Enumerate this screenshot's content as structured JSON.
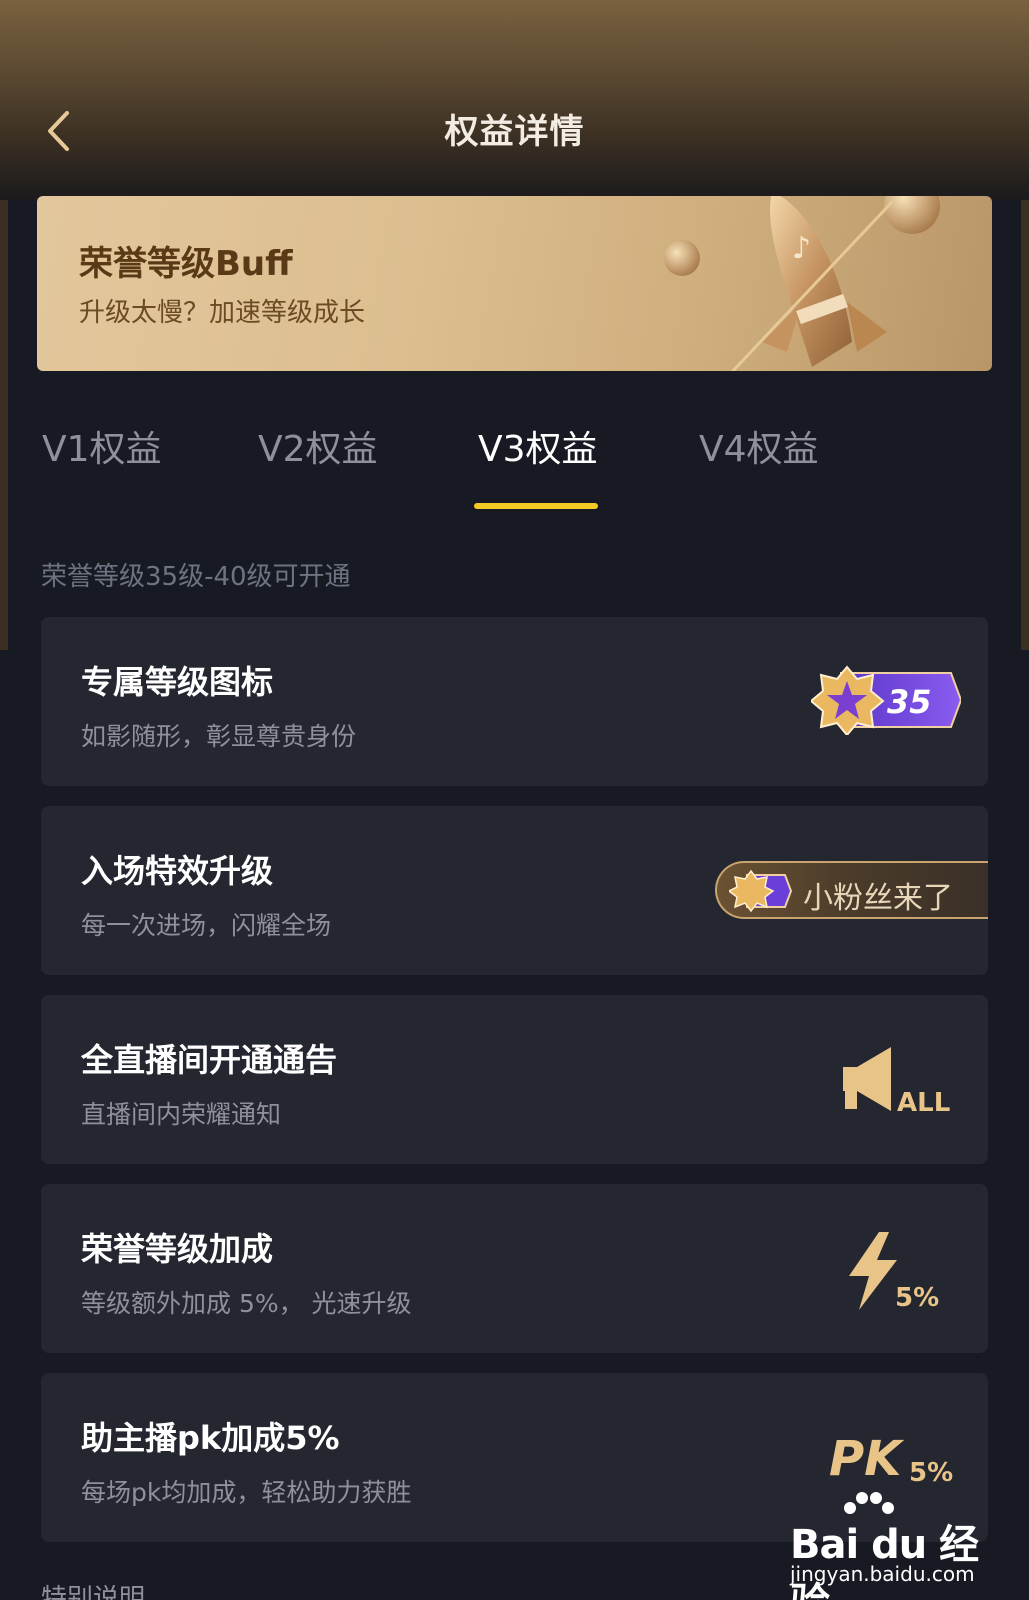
{
  "header": {
    "title": "权益详情"
  },
  "banner": {
    "title": "荣誉等级Buff",
    "subtitle": "升级太慢？加速等级成长"
  },
  "tabs": [
    {
      "label": "V1权益",
      "active": false
    },
    {
      "label": "V2权益",
      "active": false
    },
    {
      "label": "V3权益",
      "active": true
    },
    {
      "label": "V4权益",
      "active": false
    }
  ],
  "unlock_note": "荣誉等级35级-40级可开通",
  "benefits": [
    {
      "title": "专属等级图标",
      "subtitle": "如影随形，彰显尊贵身份",
      "badge_value": "35"
    },
    {
      "title": "入场特效升级",
      "subtitle": "每一次进场，闪耀全场",
      "effect_text": "小粉丝来了"
    },
    {
      "title": "全直播间开通通告",
      "subtitle": "直播间内荣耀通知",
      "icon_text": "ALL"
    },
    {
      "title": "荣誉等级加成",
      "subtitle": "等级额外加成 5%， 光速升级",
      "icon_text": "5%"
    },
    {
      "title": "助主播pk加成5%",
      "subtitle": "每场pk均加成，轻松助力获胜",
      "icon_text_main": "PK",
      "icon_text_sub": "5%"
    }
  ],
  "footer_note": "特别说明",
  "watermark": {
    "brand": "Bai du 经验",
    "url": "jingyan.baidu.com"
  },
  "colors": {
    "accent_tab": "#f3c923",
    "gold": "#e8c489",
    "card_bg": "#242630",
    "page_bg": "#181a23"
  }
}
